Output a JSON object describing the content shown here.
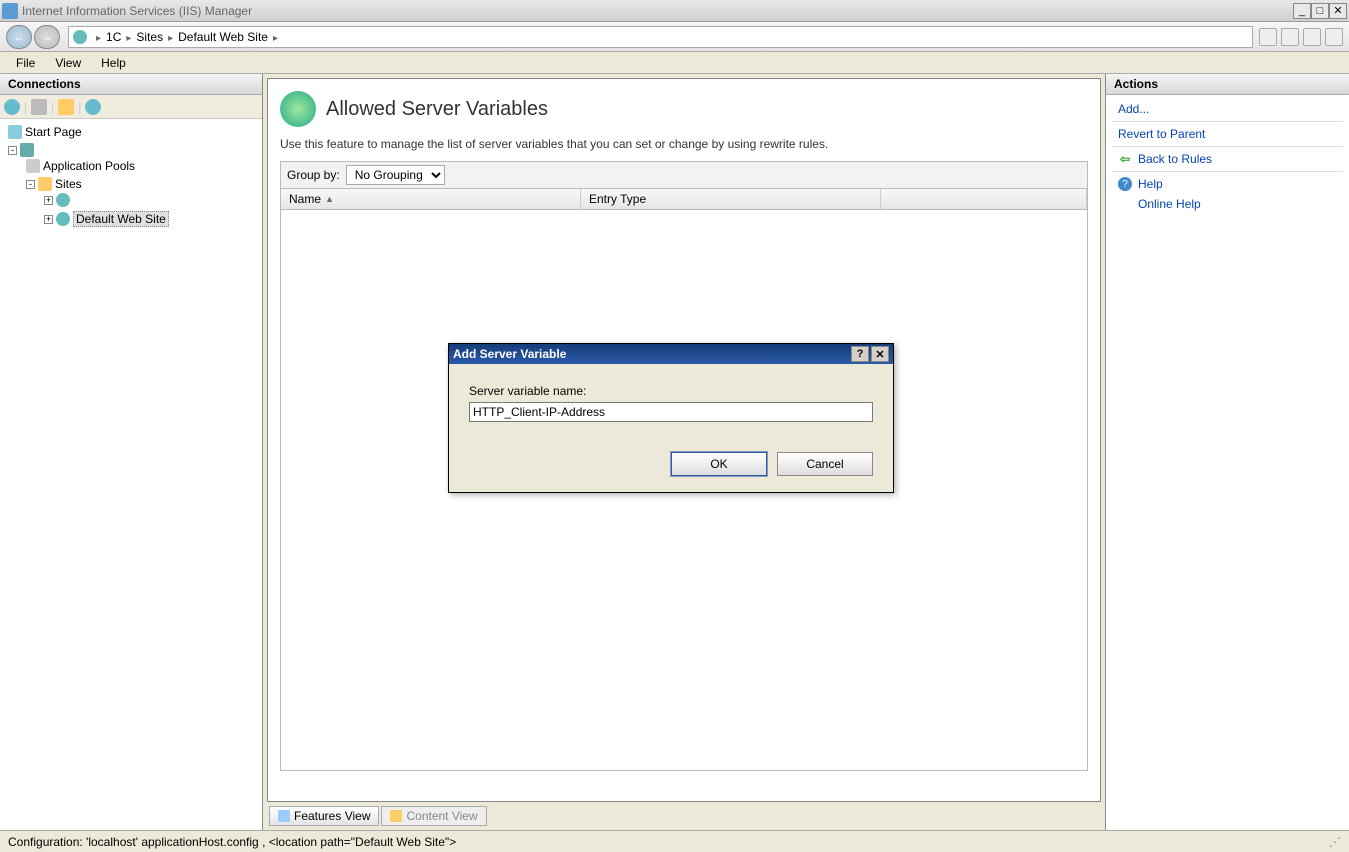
{
  "window": {
    "title": "Internet Information Services (IIS) Manager"
  },
  "breadcrumb": [
    "1C",
    "Sites",
    "Default Web Site"
  ],
  "menu": {
    "file": "File",
    "view": "View",
    "help": "Help"
  },
  "connections": {
    "header": "Connections",
    "tree": {
      "start": "Start Page",
      "server": " ",
      "app_pools": "Application Pools",
      "sites": "Sites",
      "site1": " ",
      "default_site": "Default Web Site"
    }
  },
  "content": {
    "title": "Allowed Server Variables",
    "description": "Use this feature to manage the list of server variables that you can set or change by using rewrite rules.",
    "group_by_label": "Group by:",
    "group_by_value": "No Grouping",
    "columns": {
      "name": "Name",
      "entry_type": "Entry Type"
    }
  },
  "view_tabs": {
    "features": "Features View",
    "content": "Content View"
  },
  "actions": {
    "header": "Actions",
    "add": "Add...",
    "revert": "Revert to Parent",
    "back": "Back to Rules",
    "help": "Help",
    "online_help": "Online Help"
  },
  "dialog": {
    "title": "Add Server Variable",
    "label": "Server variable name:",
    "value": "HTTP_Client-IP-Address",
    "ok": "OK",
    "cancel": "Cancel"
  },
  "status": {
    "text": "Configuration: 'localhost' applicationHost.config , <location path=\"Default Web Site\">"
  }
}
